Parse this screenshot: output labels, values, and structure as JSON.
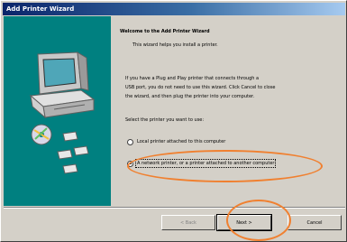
{
  "window": {
    "title": "Add Printer Wizard"
  },
  "content": {
    "heading": "Welcome to the Add Printer Wizard",
    "line1": "This wizard helps you install a printer.",
    "para1_line1": "If you have a Plug and Play printer that connects through a",
    "para1_line2": "USB port, you do not need to use this wizard. Click Cancel to close",
    "para1_line3": "the wizard, and then plug the printer into your computer.",
    "prompt": "Select the printer you want to use:",
    "options": [
      {
        "label": "Local printer attached to this computer",
        "checked": false
      },
      {
        "label": "A network printer, or a printer attached to another computer",
        "checked": true
      }
    ]
  },
  "buttons": {
    "back": "< Back",
    "next": "Next >",
    "cancel": "Cancel"
  },
  "colors": {
    "accent": "#0a246a",
    "art_background": "#008080",
    "annotation": "#f08030"
  },
  "icons": {
    "illustration": "computer-with-disks-icon"
  }
}
